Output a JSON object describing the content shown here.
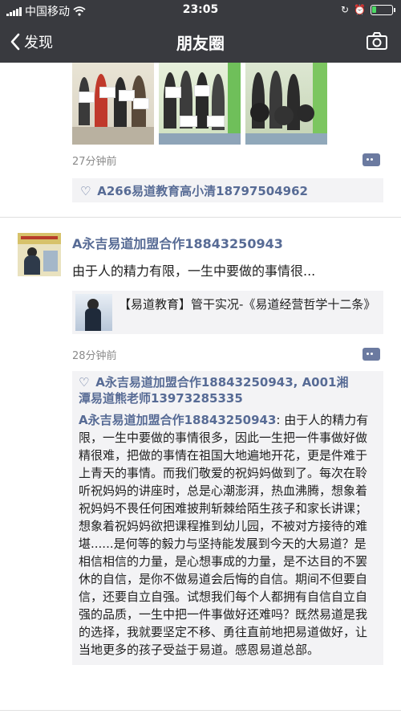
{
  "status_bar": {
    "carrier": "中国移动",
    "time": "23:05"
  },
  "nav": {
    "back_label": "发现",
    "title": "朋友圈"
  },
  "post1": {
    "time": "27分钟前",
    "likes": "A266易道教育高小清18797504962"
  },
  "post2": {
    "author": "A永吉易道加盟合作18843250943",
    "text": "由于人的精力有限，一生中要做的事情很...",
    "share_title": "【易道教育】管干实况-《易道经营哲学十二条》",
    "time": "28分钟前",
    "likes_line1": "A永吉易道加盟合作18843250943, A001湘",
    "likes_line2": "潭易道熊老师13973285335",
    "comment": {
      "author": "A永吉易道加盟合作18843250943",
      "text": ": 由于人的精力有限，一生中要做的事情很多，因此一生把一件事做好做精很难，把做的事情在祖国大地遍地开花，更是件难于上青天的事情。而我们敬爱的祝妈妈做到了。每次在聆听祝妈妈的讲座时，总是心潮澎湃，热血沸腾，想象着祝妈妈不畏任何困难披荆斩棘给陌生孩子和家长讲课；想象着祝妈妈欲把课程推到幼儿园，不被对方接待的难堪......是何等的毅力与坚持能发展到今天的大易道？是相信相信的力量，是心想事成的力量，是不达目的不罢休的自信，是你不做易道会后悔的自信。期间不但要自信，还要自立自强。试想我们每个人都拥有自信自立自强的品质，一生中把一件事做好还难吗？既然易道是我的选择，我就要坚定不移、勇往直前地把易道做好，让当地更多的孩子受益于易道。感恩易道总部。"
    }
  },
  "colors": {
    "bar": "#393a3f",
    "link": "#576b95",
    "panel": "#f3f3f5"
  }
}
